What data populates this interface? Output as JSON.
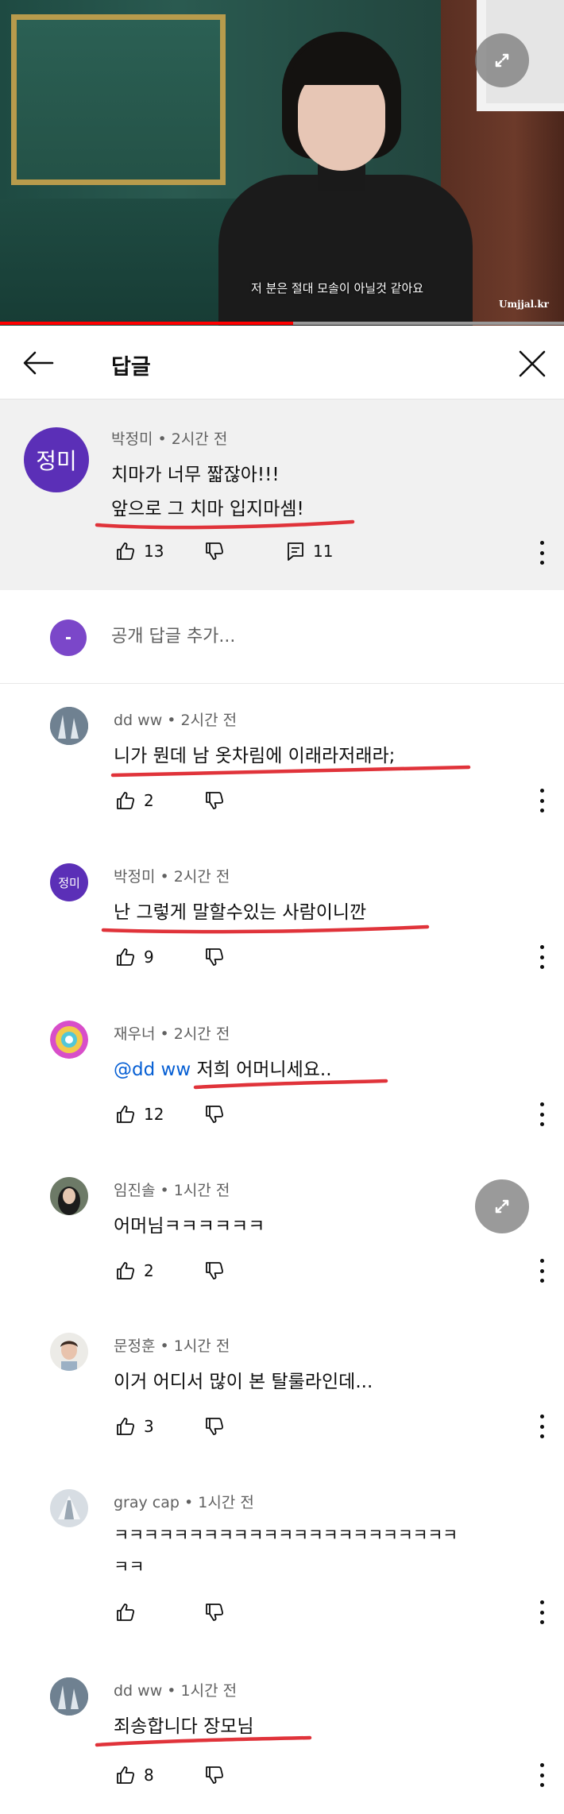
{
  "video": {
    "subtitle": "저 분은 절대 모솔이 아닐것 같아요",
    "watermark": "Umjjal.kr",
    "progress": 0.52
  },
  "header": {
    "title": "답글"
  },
  "parent_comment": {
    "avatar_text": "정미",
    "avatar_color": "#5b2fb7",
    "author_time": "박정미 • 2시간 전",
    "line1": "치마가 너무 짧잖아!!!",
    "line2": "앞으로 그 치마 입지마셈!",
    "likes": "13",
    "replies": "11"
  },
  "add_reply": {
    "placeholder": "공개 답글 추가..."
  },
  "replies": [
    {
      "author_time": "dd ww • 2시간 전",
      "text": "니가 뭔데 남 옷차림에 이래라저래라;",
      "likes": "2"
    },
    {
      "author_time": "박정미 • 2시간 전",
      "avatar_text": "정미",
      "text": "난 그렇게 말할수있는 사람이니깐",
      "likes": "9"
    },
    {
      "author_time": "재우너 • 2시간 전",
      "mention": "@dd ww",
      "text": "저희 어머니세요..",
      "likes": "12"
    },
    {
      "author_time": "임진솔 • 1시간 전",
      "text": "어머님ㅋㅋㅋㅋㅋㅋ",
      "likes": "2"
    },
    {
      "author_time": "문정훈 • 1시간 전",
      "text": "이거 어디서 많이 본 탈룰라인데...",
      "likes": "3"
    },
    {
      "author_time": "gray cap • 1시간 전",
      "text": "ㅋㅋㅋㅋㅋㅋㅋㅋㅋㅋㅋㅋㅋㅋㅋㅋㅋㅋㅋㅋㅋㅋㅋ",
      "text2": "ㅋㅋ",
      "likes": ""
    },
    {
      "author_time": "dd ww • 1시간 전",
      "text": "죄송합니다 장모님",
      "likes": "8"
    }
  ],
  "accent_color": "#e0333a"
}
